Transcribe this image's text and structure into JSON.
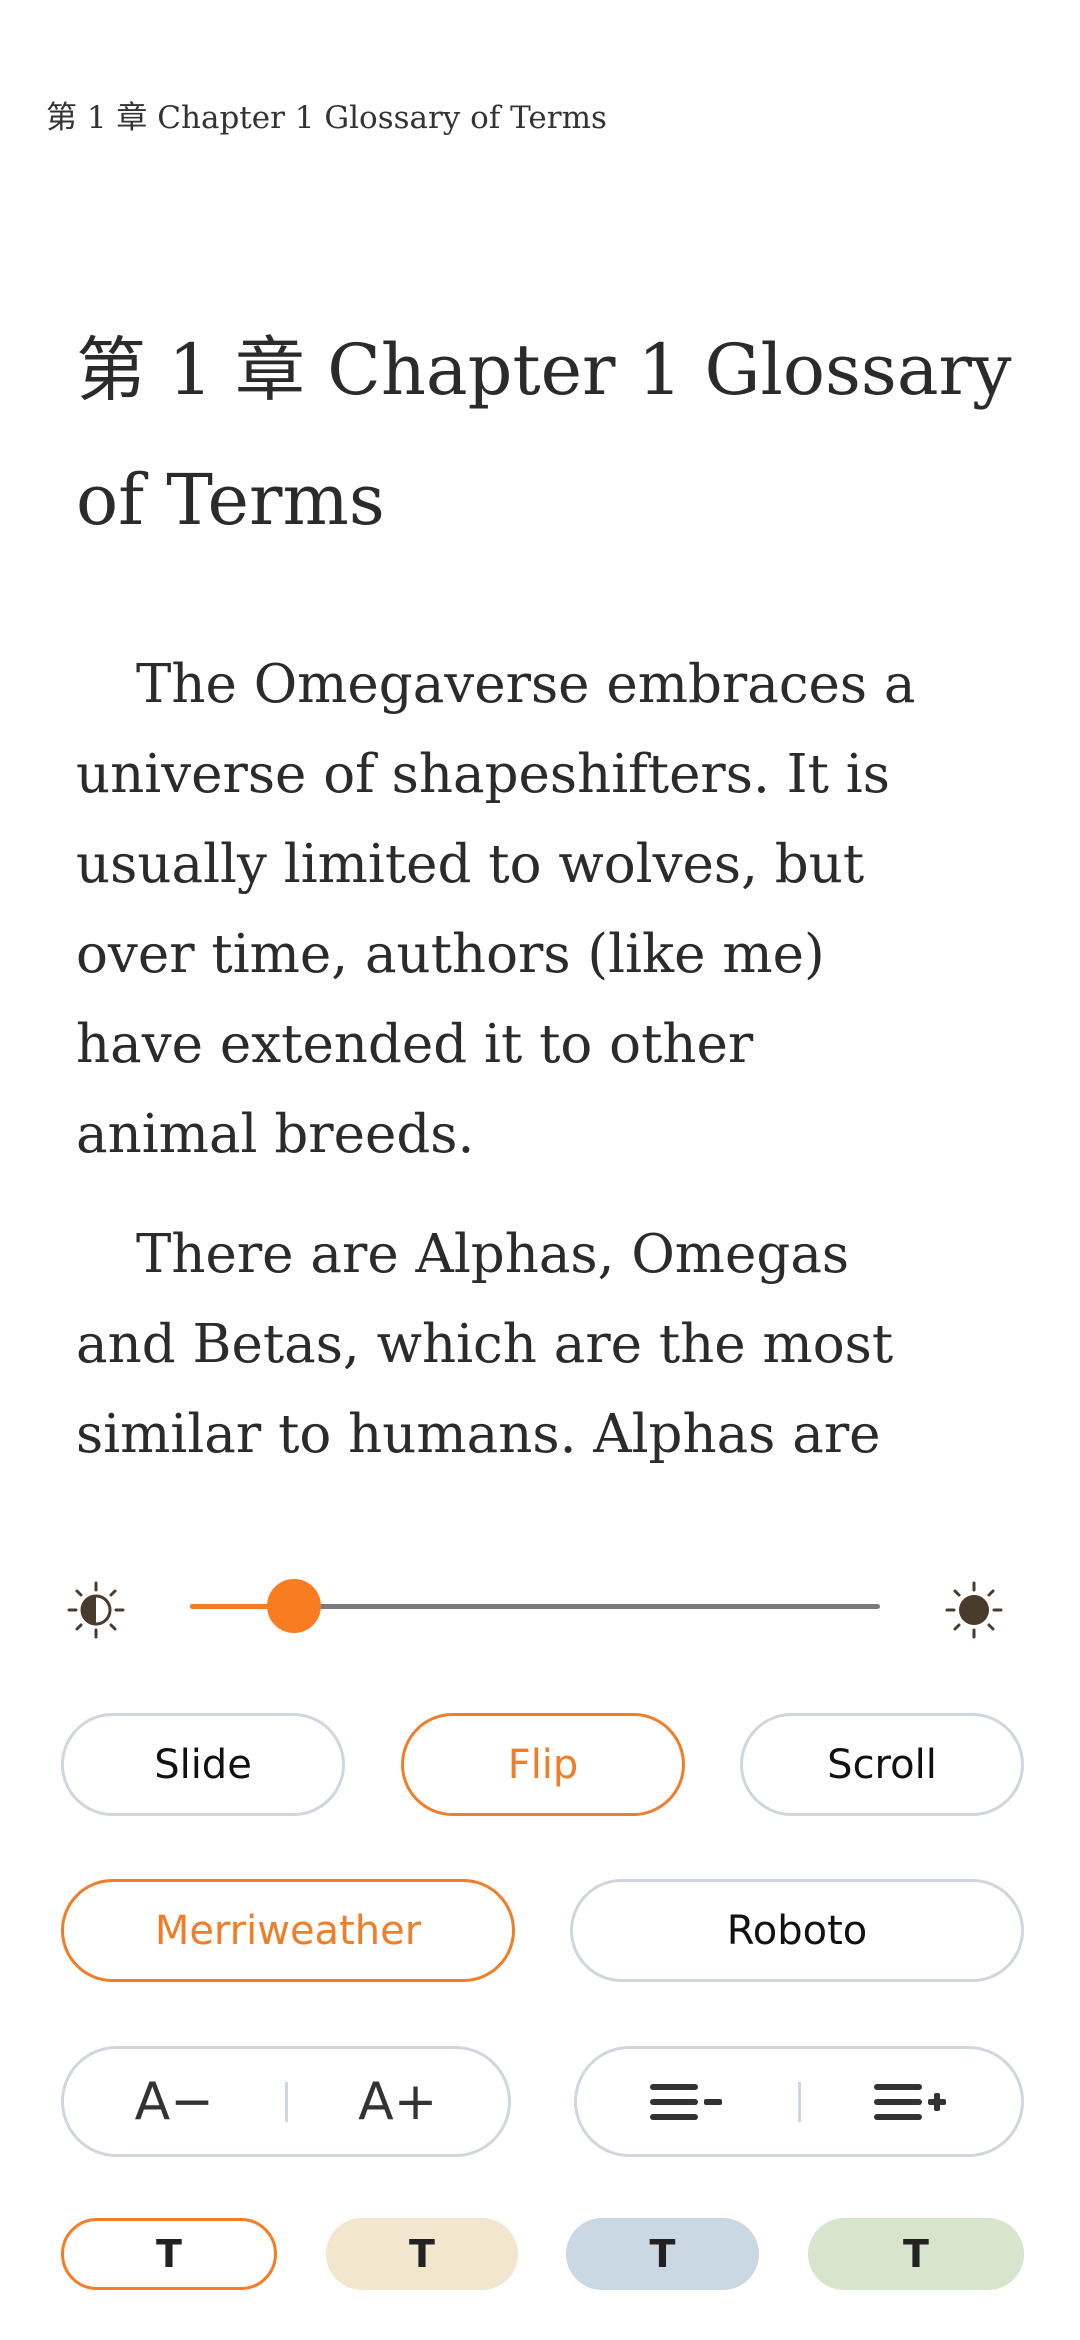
{
  "header": {
    "chapter_label": "第 1 章 Chapter 1 Glossary of Terms"
  },
  "chapter": {
    "title_lines": [
      "第 1 章 Chapter 1 Glossary",
      "of Terms"
    ]
  },
  "paragraphs": [
    [
      "The Omegaverse embraces a",
      "universe of shapeshifters. It is",
      "usually limited to wolves, but",
      "over time, authors (like me)",
      "have extended it to other",
      "animal breeds."
    ],
    [
      "There are Alphas, Omegas",
      "and Betas, which are the most",
      "similar to humans. Alphas are"
    ]
  ],
  "brightness": {
    "value_percent": 15,
    "accent": "#f97c20"
  },
  "page_mode": {
    "options": [
      "Slide",
      "Flip",
      "Scroll"
    ],
    "selected": "Flip"
  },
  "font": {
    "options": [
      "Merriweather",
      "Roboto"
    ],
    "selected": "Merriweather"
  },
  "font_size": {
    "decrease": "A−",
    "increase": "A+"
  },
  "themes": {
    "label": "T",
    "colors": [
      "#ffffff",
      "#f2e6ce",
      "#cad8e4",
      "#d7e5cc"
    ],
    "selected": 0
  }
}
